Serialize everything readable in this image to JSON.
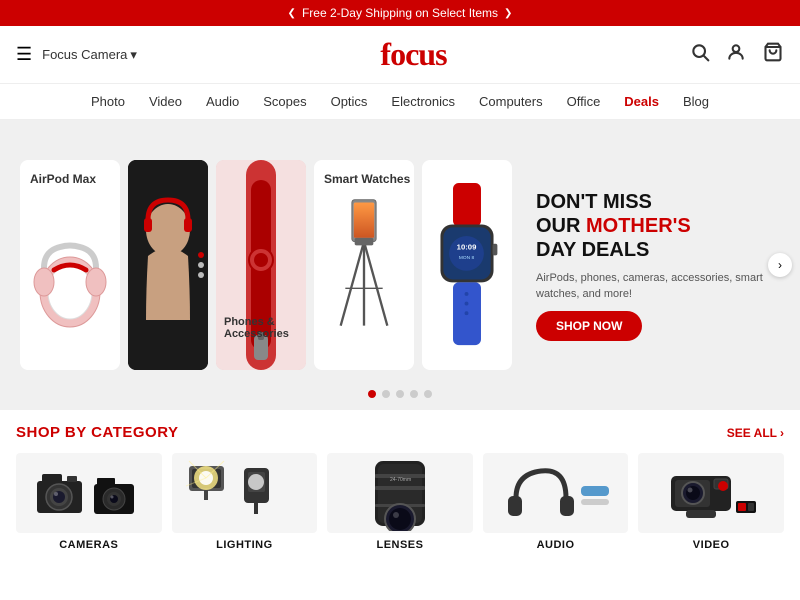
{
  "banner": {
    "text": "Free 2-Day Shipping on Select Items",
    "left_arrow": "❮",
    "right_arrow": "❯"
  },
  "header": {
    "hamburger": "☰",
    "store_name": "Focus Camera",
    "store_chevron": "▾",
    "logo": "focus",
    "search_icon": "🔍",
    "user_icon": "👤",
    "cart_icon": "🛒"
  },
  "nav": {
    "items": [
      {
        "label": "Photo",
        "id": "photo"
      },
      {
        "label": "Video",
        "id": "video"
      },
      {
        "label": "Audio",
        "id": "audio"
      },
      {
        "label": "Scopes",
        "id": "scopes"
      },
      {
        "label": "Optics",
        "id": "optics"
      },
      {
        "label": "Electronics",
        "id": "electronics"
      },
      {
        "label": "Computers",
        "id": "computers"
      },
      {
        "label": "Office",
        "id": "office"
      },
      {
        "label": "Deals",
        "id": "deals",
        "special": true
      },
      {
        "label": "Blog",
        "id": "blog"
      }
    ]
  },
  "hero": {
    "cards": [
      {
        "id": "airpod",
        "label": "AirPod Max"
      },
      {
        "id": "person",
        "label": ""
      },
      {
        "id": "phone",
        "label": "Phones & Accessories"
      },
      {
        "id": "smartwatch",
        "label": "Smart Watches"
      },
      {
        "id": "watch_big",
        "label": ""
      }
    ],
    "promo": {
      "line1": "DON'T MISS",
      "line2": "OUR ",
      "highlight": "MOTHER'S",
      "line3": " DAY DEALS",
      "description": "AirPods, phones, cameras, accessories, smart watches, and more!",
      "button": "SHOP NOW"
    },
    "dots": [
      true,
      false,
      false,
      false,
      false
    ]
  },
  "category": {
    "title": "SHOP BY CATEGORY",
    "see_all": "SEE ALL",
    "items": [
      {
        "label": "CAMERAS",
        "id": "cameras"
      },
      {
        "label": "LIGHTING",
        "id": "lighting"
      },
      {
        "label": "LENSES",
        "id": "lenses"
      },
      {
        "label": "AUDIO",
        "id": "audio"
      },
      {
        "label": "VIDEO",
        "id": "video"
      }
    ]
  }
}
